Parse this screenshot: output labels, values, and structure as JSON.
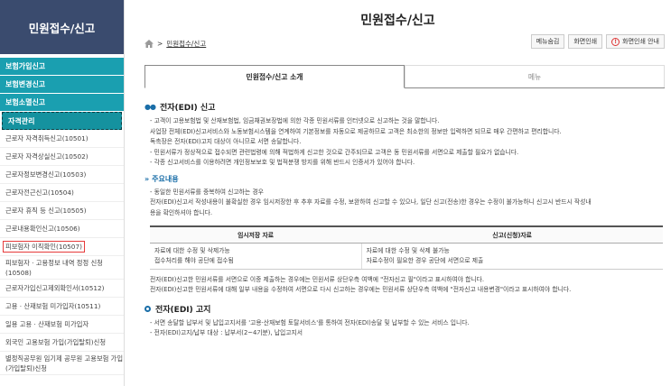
{
  "sidebar": {
    "title": "민원접수/신고",
    "groups": [
      "보험가입신고",
      "보험변경신고",
      "보험소멸신고",
      "자격관리"
    ],
    "items": [
      "근로자 자격취득신고(10501)",
      "근로자 자격상실신고(10502)",
      "근로자정보변경신고(10503)",
      "근로자전근신고(10504)",
      "근로자 휴직 등 신고(10505)",
      "근로내용확인신고(10506)",
      "피보험자 이직확인(10507)",
      "피보험자 · 고용정보 내역 정정 신청(10508)",
      "근로자가입신고제외확인서(10512)",
      "고용 · 산재보험 미가입자(10511)",
      "일용 고용 · 산재보험 미가입자",
      "외국인 고용보험 가입(가입탈퇴)신청",
      "별정직공무원 임기제 공무원 고용보험 가입(가입탈퇴)신청"
    ]
  },
  "header": {
    "title": "민원접수/신고",
    "breadcrumb": "민원접수/신고",
    "buttons": {
      "menu_hide": "메뉴숨김",
      "print": "화면인쇄",
      "print_guide": "화면인쇄 안내"
    }
  },
  "tabs": [
    "민원접수/신고 소개",
    "메뉴"
  ],
  "section1": {
    "title": "전자(EDI) 신고",
    "bullets": [
      "고객이 고용보험법 및 산재보험법, 임금채권보장법에 의한 각종 민원서류를 인터넷으로 신고하는 것을 말합니다.",
      "사업장 전체(EDI)신고서비스와 노동보험시스템을 연계하여 기본정보를 자동으로 제공하므로 고객은 최소한의 정보만 입력하면 되므로 매우 간편하고 편리합니다.",
      "독촉장은 전자(EDI)고지 대상이 아니므로 서면 송달합니다.",
      "민원서류가 정상적으로 접수되면 관련법령에 의해 적법하게 신고한 것으로 간주되므로 고객은 동 민원서류를 서면으로 제출할 필요가 없습니다.",
      "각종 신고서비스를 이용하려면 개인정보보호 및 법적분쟁 방지를 위해 반드시 인증서가 있어야 합니다."
    ]
  },
  "sub1": {
    "title": "주요내용",
    "bullet": "동일한 민원서류를 중복하여 신고하는 경우",
    "cont1": "전자(EDI)신고서 작성내용이 불확실한 경우 임시저장한 후 추후 자료를 수정, 보완하여 신고할 수 있으나, 일단 신고(전송)한 경우는 수정이 불가능하니 신고시 반드시 작성내",
    "cont2": "용을 확인하셔야 합니다."
  },
  "table": {
    "headers": [
      "임시저장 자료",
      "신고(신청)자료"
    ],
    "rows": [
      [
        "자료에 대한 수정 및 삭제가능",
        "자료에 대한 수정 및 삭제 불가능"
      ],
      [
        "접수처리를 해야 공단에 접수됨",
        "자료수정이 필요한 경우 공단에 서면으로 제출"
      ]
    ]
  },
  "notes": [
    "전자(EDI)신고한 민원서류를 서면으로 이중 제출하는 경우에는 민원서류 상단우측 여백에 \"전자신고 필\"이라고 표시하여야 합니다.",
    "전자(EDI)신고한 민원서류에 대해 일부 내용을 수정하여 서면으로 다시 신고하는 경우에는 민원서류 상단우측 여백에 \"전자신고 내용변경\"이라고 표시하여야 합니다."
  ],
  "section2": {
    "title": "전자(EDI) 고지",
    "bullets": [
      "서면 송달할 납부서 및 납입고지서를 '고용·산재보험 토탈서비스'를 통하여 전자(EDI)송달 및 납부할 수 있는 서비스 입니다.",
      "전자(EDI)고지/납부 대상 : 납부서(2~4기분), 납입고지서"
    ]
  },
  "colors": {
    "sidebar_head": "#3a4b6e",
    "sidebar_group": "#1a9fb0",
    "accent": "#1a6ea8",
    "highlight": "#e63b3b"
  }
}
